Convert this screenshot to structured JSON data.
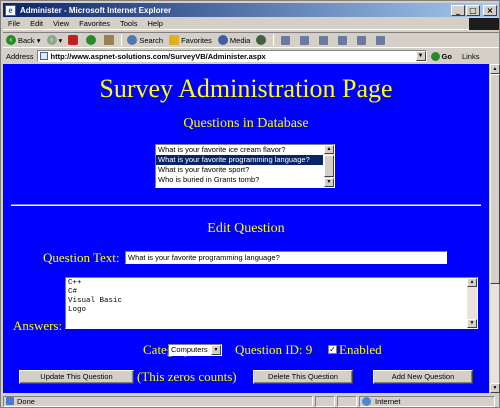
{
  "window": {
    "title": "Administer - Microsoft Internet Explorer",
    "min_glyph": "_",
    "max_glyph": "□",
    "close_glyph": "×"
  },
  "menu": [
    "File",
    "Edit",
    "View",
    "Favorites",
    "Tools",
    "Help"
  ],
  "toolbar": {
    "back": "Back",
    "search": "Search",
    "favorites": "Favorites",
    "media": "Media"
  },
  "address": {
    "label": "Address",
    "url": "http://www.aspnet-solutions.com/SurveyVB/Administer.aspx",
    "go": "Go",
    "links": "Links"
  },
  "page": {
    "title": "Survey Administration Page",
    "questions_heading": "Questions in Database",
    "questions": [
      "What is your favorite ice cream flavor?",
      "What is your favorite programming language?",
      "What is your favorite sport?",
      "Who is buried in Grants tomb?"
    ],
    "selected_index": 1,
    "edit_heading": "Edit Question",
    "question_text_label": "Question Text:",
    "question_text_value": "What is your favorite programming language?",
    "answers_label": "Answers:",
    "answers": [
      "C++",
      "C#",
      "Visual Basic",
      "Logo"
    ],
    "category_label": "Category:",
    "category_value": "Computers",
    "question_id_text": "Question ID: 9",
    "enabled_checked": true,
    "enabled_label": "Enabled",
    "buttons": {
      "update": "Update This Question",
      "delete": "Delete This Question",
      "add": "Add New Question"
    },
    "note": "(This zeros counts)"
  },
  "status": {
    "left": "Done",
    "zone": "Internet"
  },
  "colors": {
    "page_bg": "#0000ff",
    "page_text": "#ffff00",
    "chrome": "#d4d0c8"
  }
}
